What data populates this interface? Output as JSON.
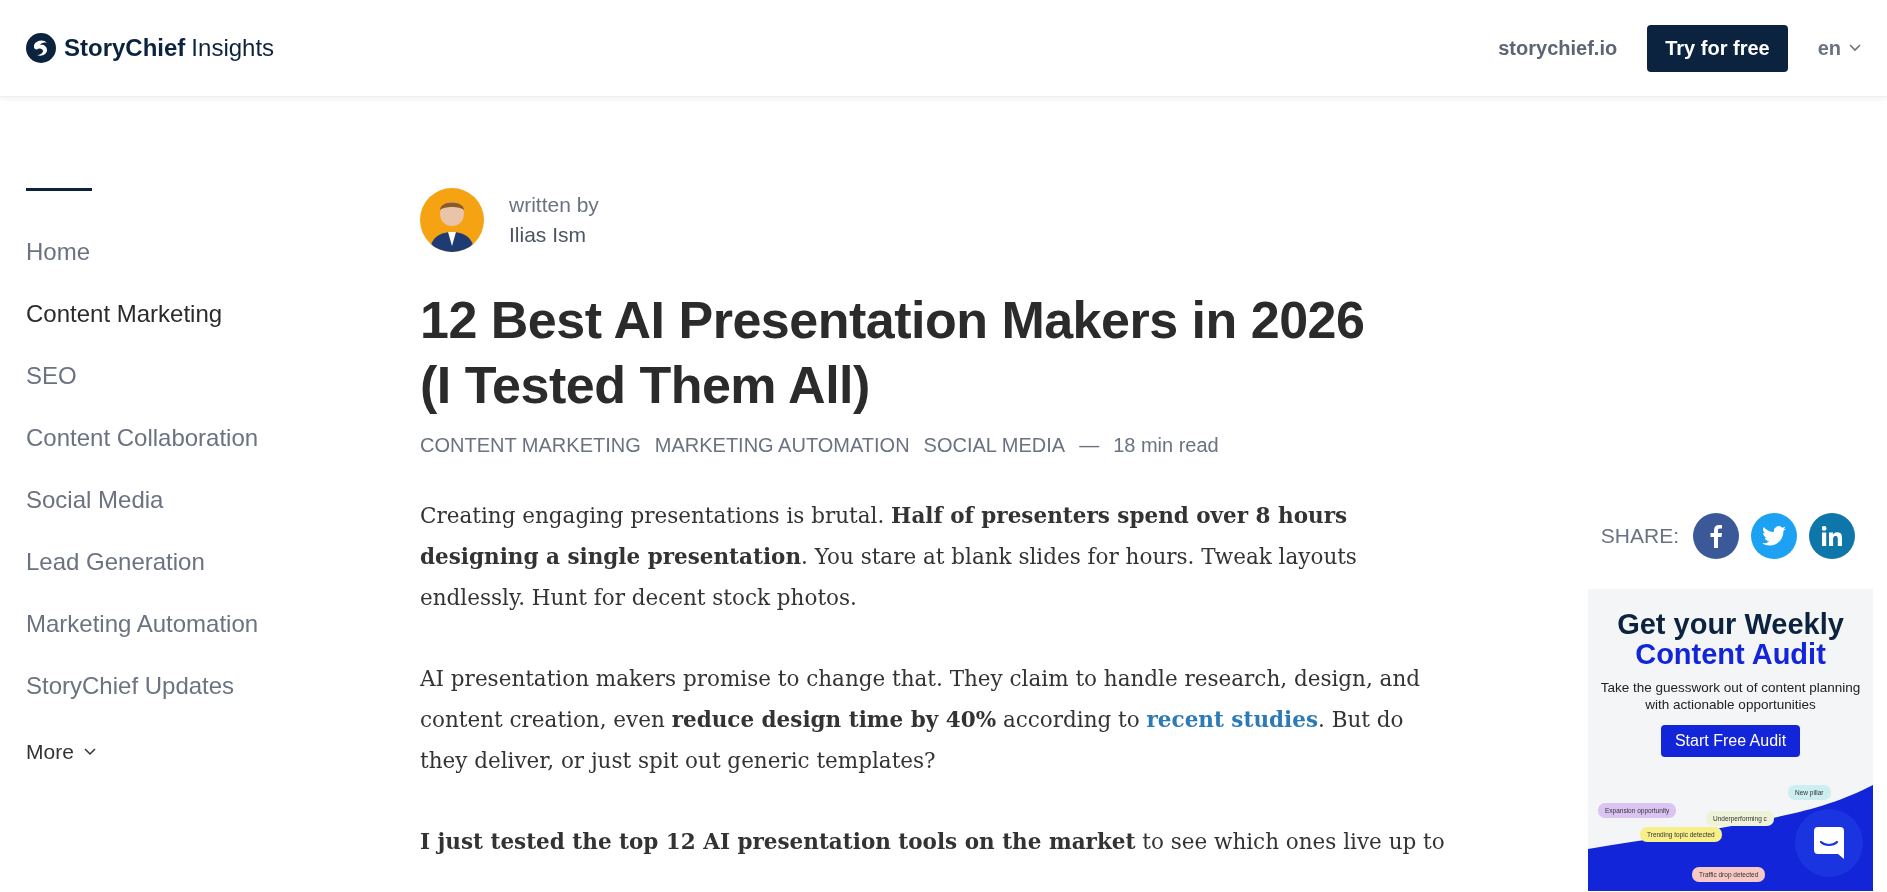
{
  "header": {
    "brand": "StoryChief",
    "brand_suffix": "Insights",
    "site_link": "storychief.io",
    "cta": "Try for free",
    "language": "en"
  },
  "sidebar": {
    "items": [
      {
        "label": "Home",
        "selected": false
      },
      {
        "label": "Content Marketing",
        "selected": true
      },
      {
        "label": "SEO",
        "selected": false
      },
      {
        "label": "Content Collaboration",
        "selected": false
      },
      {
        "label": "Social Media",
        "selected": false
      },
      {
        "label": "Lead Generation",
        "selected": false
      },
      {
        "label": "Marketing Automation",
        "selected": false
      },
      {
        "label": "StoryChief Updates",
        "selected": false
      }
    ],
    "more": "More"
  },
  "article": {
    "author_label": "written by",
    "author": "Ilias Ism",
    "title": "12 Best AI Presentation Makers in 2026 (I Tested Them All)",
    "tags": [
      "CONTENT MARKETING",
      "MARKETING AUTOMATION",
      "SOCIAL MEDIA"
    ],
    "separator": "—",
    "read_time": "18 min read",
    "paragraphs": [
      [
        {
          "kind": "plain",
          "text": "Creating engaging presentations is brutal. "
        },
        {
          "kind": "bold",
          "text": "Half of presenters spend over 8 hours designing a single presentation"
        },
        {
          "kind": "plain",
          "text": ". You stare at blank slides for hours. Tweak layouts endlessly. Hunt for decent stock photos."
        }
      ],
      [
        {
          "kind": "plain",
          "text": "AI presentation makers promise to change that. They claim to handle research, design, and content creation, even "
        },
        {
          "kind": "bold",
          "text": "reduce design time by 40%"
        },
        {
          "kind": "plain",
          "text": " according to "
        },
        {
          "kind": "link",
          "text": "recent studies"
        },
        {
          "kind": "plain",
          "text": ". But do they deliver, or just spit out generic templates?"
        }
      ],
      [
        {
          "kind": "bold",
          "text": "I just tested the top 12 AI presentation tools on the market"
        },
        {
          "kind": "plain",
          "text": " to see which ones live up to"
        }
      ]
    ]
  },
  "share": {
    "label": "SHARE:",
    "buttons": [
      {
        "kind": "facebook"
      },
      {
        "kind": "twitter"
      },
      {
        "kind": "linkedin"
      }
    ]
  },
  "ad": {
    "headline": "Get your Weekly",
    "headline_accent": "Content Audit",
    "text": "Take the guesswork out of content planning with actionable opportunities",
    "button": "Start Free Audit",
    "chips": [
      {
        "label": "Expansion opportunity",
        "color": "#dcc4f2"
      },
      {
        "label": "Trending topic detected",
        "color": "#f7ef8a"
      },
      {
        "label": "Underperforming c",
        "color": "#eef2d8"
      },
      {
        "label": "New pillar",
        "color": "#cdeef0"
      },
      {
        "label": "Traffic drop detected",
        "color": "#f7c9c4"
      }
    ]
  }
}
